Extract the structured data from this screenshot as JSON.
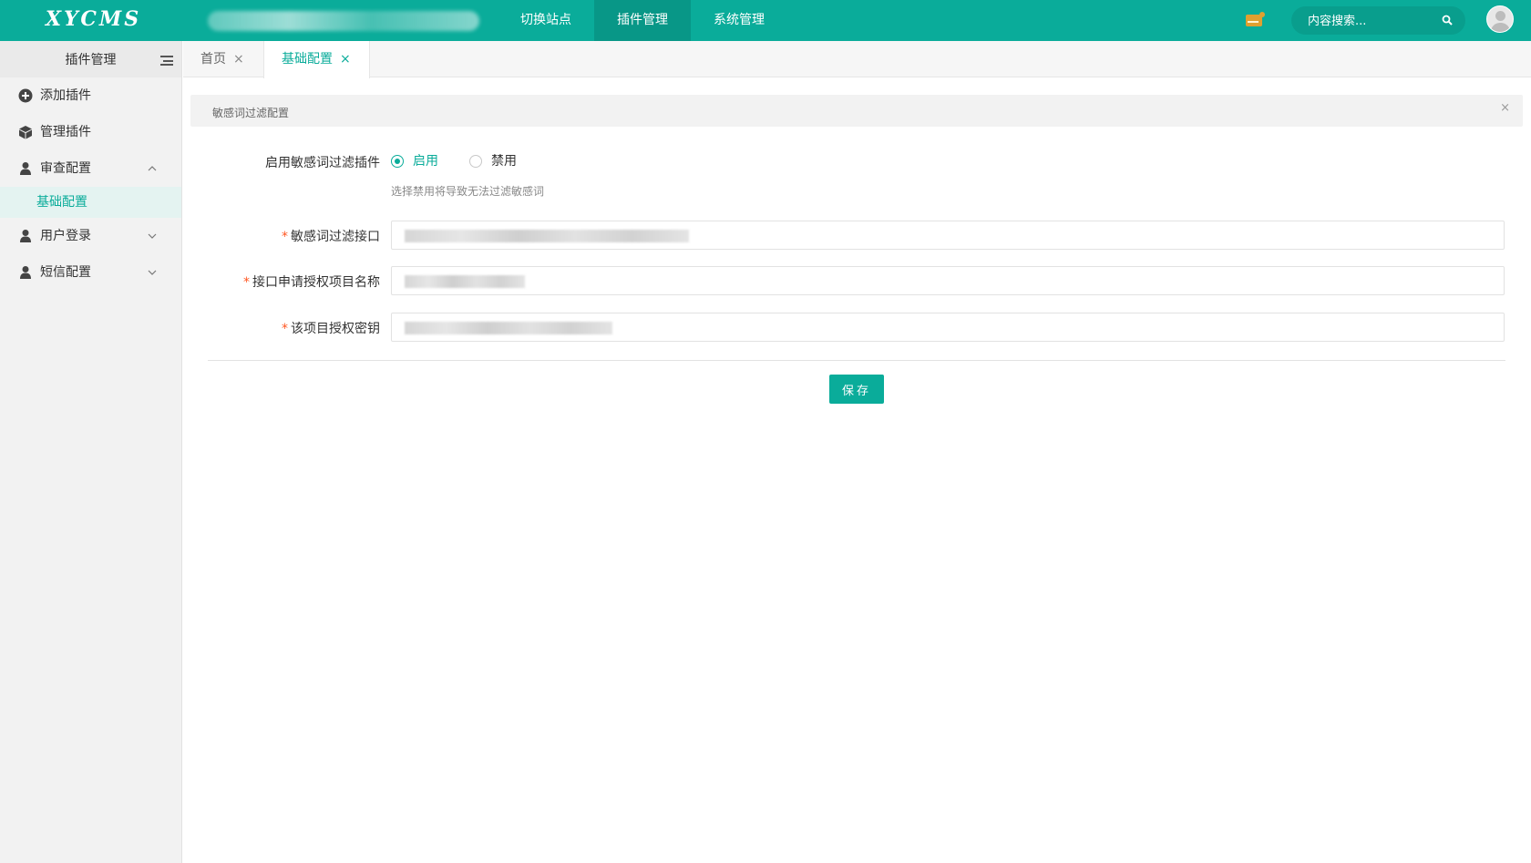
{
  "header": {
    "logo_text": "XYCMS",
    "nav": [
      {
        "label": "切换站点",
        "active": false
      },
      {
        "label": "插件管理",
        "active": true
      },
      {
        "label": "系统管理",
        "active": false
      }
    ],
    "search_placeholder": "内容搜索...",
    "colors": {
      "primary": "#0aac9a",
      "mail_icon": "#e0a030"
    }
  },
  "sidebar": {
    "title": "插件管理",
    "items": [
      {
        "label": "添加插件",
        "icon": "plus-circle-icon"
      },
      {
        "label": "管理插件",
        "icon": "cube-icon"
      },
      {
        "label": "审查配置",
        "icon": "user-icon",
        "expanded": true,
        "children": [
          {
            "label": "基础配置",
            "active": true
          }
        ]
      },
      {
        "label": "用户登录",
        "icon": "user-icon",
        "expanded": false
      },
      {
        "label": "短信配置",
        "icon": "user-icon",
        "expanded": false
      }
    ]
  },
  "tabs": [
    {
      "label": "首页",
      "close": "×",
      "active": false
    },
    {
      "label": "基础配置",
      "close": "×",
      "active": true
    }
  ],
  "alert": {
    "text": "敏感词过滤配置",
    "close": "×"
  },
  "form": {
    "enable_label": "启用敏感词过滤插件",
    "radio_options": [
      {
        "label": "启用",
        "checked": true
      },
      {
        "label": "禁用",
        "checked": false
      }
    ],
    "hint": "选择禁用将导致无法过滤敏感词",
    "required_mark": "*",
    "fields": [
      {
        "label": "敏感词过滤接口",
        "required": true
      },
      {
        "label": "接口申请授权项目名称",
        "required": true
      },
      {
        "label": "该项目授权密钥",
        "required": true
      }
    ],
    "save_label": "保存"
  }
}
